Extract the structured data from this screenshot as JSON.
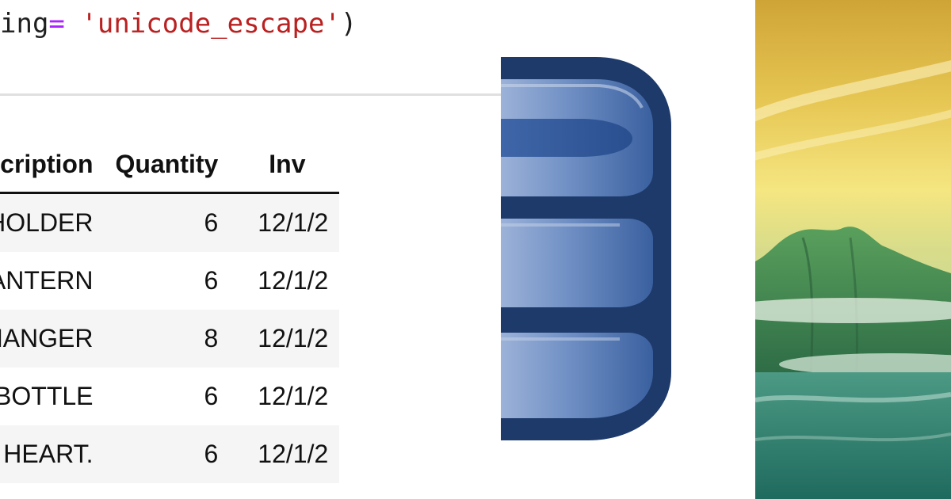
{
  "notebook": {
    "code_tokens": {
      "name": "ing",
      "op": "=",
      "string": " 'unicode_escape'",
      "close": ")"
    },
    "table": {
      "columns": [
        "Description",
        "Quantity",
        "Inv"
      ],
      "rows": [
        {
          "description": "ART T-LIGHT HOLDER",
          "quantity": "6",
          "invoice_date": "12/1/2"
        },
        {
          "description": "ITE METAL LANTERN",
          "quantity": "6",
          "invoice_date": "12/1/2"
        },
        {
          "description": "ARTS COAT HANGER",
          "quantity": "8",
          "invoice_date": "12/1/2"
        },
        {
          "description": "HOT WATER BOTTLE",
          "quantity": "6",
          "invoice_date": "12/1/2"
        },
        {
          "description": "OTTIE WHITE HEART.",
          "quantity": "6",
          "invoice_date": "12/1/2"
        }
      ]
    }
  },
  "icons": {
    "database": "database-icon",
    "landscape": "landscape-image"
  },
  "colors": {
    "code_string": "#ba2121",
    "code_operator": "#aa22ff",
    "db_outline": "#1d3a6b",
    "db_fill_dark": "#2f5597",
    "db_fill_light": "#8fa8d4",
    "sky_top": "#d9ad3c",
    "sky_mid": "#f4e57a",
    "mountain": "#3f8c4e",
    "water": "#2d7e72"
  }
}
